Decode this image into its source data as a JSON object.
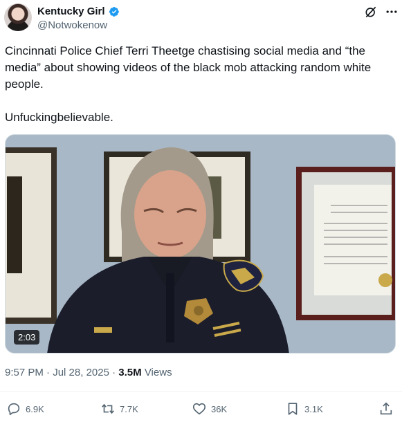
{
  "author": {
    "name": "Kentucky Girl",
    "handle": "@Notwokenow",
    "verified": true,
    "avatar_icon": "profile-photo"
  },
  "tweet": {
    "paragraphs": [
      "Cincinnati Police Chief Terri Theetge chastising social media and “the media” about showing videos of the black mob attacking random white people.",
      "Unfuckingbelievable."
    ]
  },
  "media": {
    "type": "video",
    "duration": "2:03"
  },
  "meta": {
    "time": "9:57 PM",
    "separator1": " · ",
    "date": "Jul 28, 2025",
    "separator2": " · ",
    "views_count": "3.5M",
    "views_label": " Views"
  },
  "actions": {
    "replies": "6.9K",
    "reposts": "7.7K",
    "likes": "36K",
    "bookmarks": "3.1K"
  },
  "colors": {
    "text_primary": "#0f1419",
    "text_secondary": "#536471",
    "verified_blue": "#1d9bf0"
  }
}
